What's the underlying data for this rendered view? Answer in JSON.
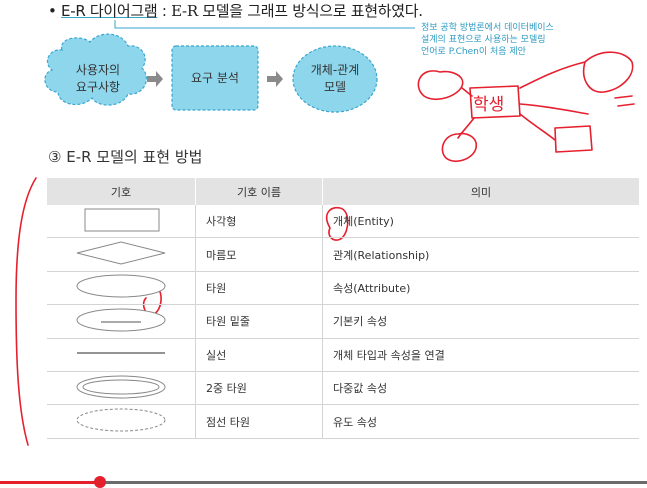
{
  "bullet": {
    "dot": "•",
    "term": "E-R 다이어그램",
    "separator": " : ",
    "description": "E-R 모델을 그래프 방식으로 표현하였다."
  },
  "side_note": {
    "line1": "정보 공학 방법론에서 데이터베이스",
    "line2": "설계의 표현으로 사용하는 모델링",
    "line3": "언어로 P.Chen이 처음 제안"
  },
  "flow": {
    "step1_line1": "사용자의",
    "step1_line2": "요구사항",
    "step2": "요구 분석",
    "step3_line1": "개체-관계",
    "step3_line2": "모델",
    "arrow_glyph": "➡"
  },
  "section": {
    "heading": "③ E-R 모델의 표현 방법"
  },
  "table": {
    "headers": [
      "기호",
      "기호 이름",
      "의미"
    ],
    "rows": [
      {
        "symbol": "rectangle-symbol",
        "name": "사각형",
        "meaning": "개체(Entity)"
      },
      {
        "symbol": "diamond-symbol",
        "name": "마름모",
        "meaning": "관계(Relationship)"
      },
      {
        "symbol": "ellipse-symbol",
        "name": "타원",
        "meaning": "속성(Attribute)"
      },
      {
        "symbol": "underlined-ellipse-symbol",
        "name": "타원 밑줄",
        "meaning": "기본키 속성"
      },
      {
        "symbol": "solid-line-symbol",
        "name": "실선",
        "meaning": "개체 타입과 속성을 연결"
      },
      {
        "symbol": "double-ellipse-symbol",
        "name": "2중 타원",
        "meaning": "다중값 속성"
      },
      {
        "symbol": "dashed-ellipse-symbol",
        "name": "점선 타원",
        "meaning": "유도 속성"
      }
    ]
  },
  "annotations": {
    "handwritten_word": "학생"
  },
  "colors": {
    "cloud_fill": "#8ed6ec",
    "dashed_outline": "#39a6cf",
    "header_gray": "#e3e3e3",
    "pen_red": "#e5202f",
    "progress_red": "#e3202b"
  },
  "video_progress": {
    "played_fraction": 0.155
  }
}
